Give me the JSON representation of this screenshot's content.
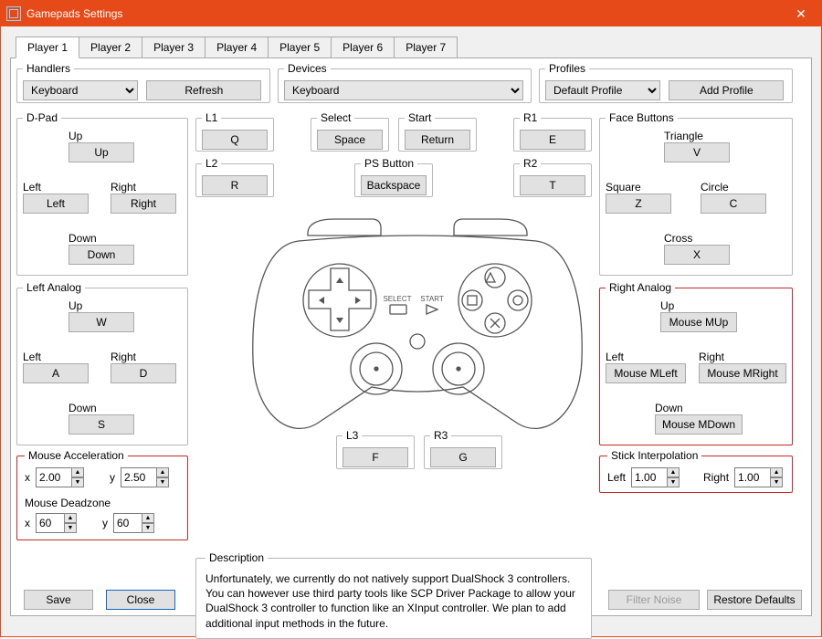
{
  "window": {
    "title": "Gamepads Settings"
  },
  "tabs": [
    "Player 1",
    "Player 2",
    "Player 3",
    "Player 4",
    "Player 5",
    "Player 6",
    "Player 7"
  ],
  "active_tab": 0,
  "handlers": {
    "legend": "Handlers",
    "selected": "Keyboard",
    "refresh": "Refresh"
  },
  "devices": {
    "legend": "Devices",
    "selected": "Keyboard"
  },
  "profiles": {
    "legend": "Profiles",
    "selected": "Default Profile",
    "add": "Add Profile"
  },
  "dpad": {
    "legend": "D-Pad",
    "up_lbl": "Up",
    "up": "Up",
    "left_lbl": "Left",
    "left": "Left",
    "right_lbl": "Right",
    "right": "Right",
    "down_lbl": "Down",
    "down": "Down"
  },
  "l1": {
    "legend": "L1",
    "key": "Q"
  },
  "l2": {
    "legend": "L2",
    "key": "R"
  },
  "select": {
    "legend": "Select",
    "key": "Space"
  },
  "start": {
    "legend": "Start",
    "key": "Return"
  },
  "ps": {
    "legend": "PS Button",
    "key": "Backspace"
  },
  "r1": {
    "legend": "R1",
    "key": "E"
  },
  "r2": {
    "legend": "R2",
    "key": "T"
  },
  "face": {
    "legend": "Face Buttons",
    "triangle_lbl": "Triangle",
    "triangle": "V",
    "square_lbl": "Square",
    "square": "Z",
    "circle_lbl": "Circle",
    "circle": "C",
    "cross_lbl": "Cross",
    "cross": "X"
  },
  "left_analog": {
    "legend": "Left Analog",
    "up_lbl": "Up",
    "up": "W",
    "left_lbl": "Left",
    "left": "A",
    "right_lbl": "Right",
    "right": "D",
    "down_lbl": "Down",
    "down": "S"
  },
  "right_analog": {
    "legend": "Right Analog",
    "up_lbl": "Up",
    "up": "Mouse MUp",
    "left_lbl": "Left",
    "left": "Mouse MLeft",
    "right_lbl": "Right",
    "right": "Mouse MRight",
    "down_lbl": "Down",
    "down": "Mouse MDown"
  },
  "l3": {
    "legend": "L3",
    "key": "F"
  },
  "r3": {
    "legend": "R3",
    "key": "G"
  },
  "mouse_accel": {
    "legend": "Mouse Acceleration",
    "x_lbl": "x",
    "x": "2.00",
    "y_lbl": "y",
    "y": "2.50"
  },
  "mouse_dead": {
    "legend": "Mouse Deadzone",
    "x_lbl": "x",
    "x": "60",
    "y_lbl": "y",
    "y": "60"
  },
  "stick_interp": {
    "legend": "Stick Interpolation",
    "left_lbl": "Left",
    "left": "1.00",
    "right_lbl": "Right",
    "right": "1.00"
  },
  "description": {
    "legend": "Description",
    "text": "Unfortunately, we currently do not natively support DualShock 3 controllers. You can however use third party tools like SCP Driver Package to allow your DualShock 3 controller to function like an XInput controller. We plan to add additional input methods in the future."
  },
  "buttons": {
    "save": "Save",
    "close": "Close",
    "filter_noise": "Filter Noise",
    "restore": "Restore Defaults"
  }
}
